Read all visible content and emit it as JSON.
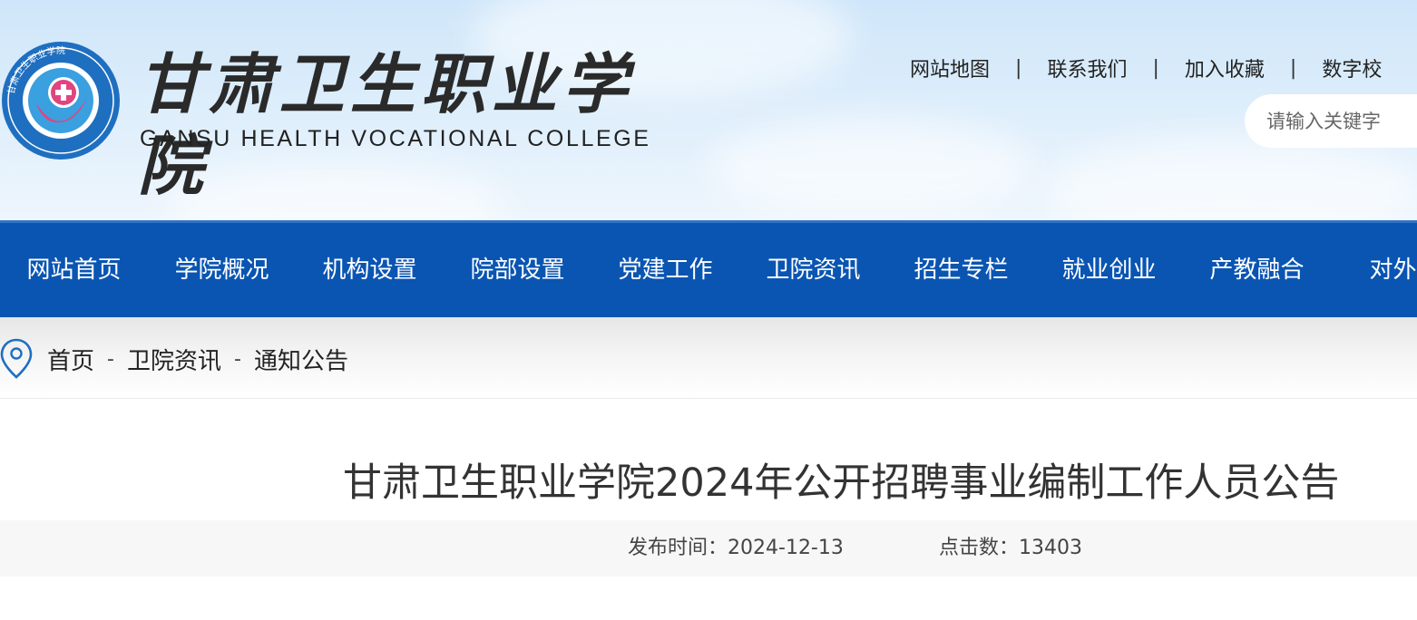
{
  "logo": {
    "name_cn": "甘肃卫生职业学院",
    "name_en": "GANSU HEALTH VOCATIONAL COLLEGE",
    "emblem_ring_text": "甘肃卫生职业学院"
  },
  "top_links": [
    "网站地图",
    "联系我们",
    "加入收藏",
    "数字校"
  ],
  "top_link_separator": "|",
  "search": {
    "placeholder": "请输入关键字"
  },
  "nav": {
    "items": [
      "网站首页",
      "学院概况",
      "机构设置",
      "院部设置",
      "党建工作",
      "卫院资讯",
      "招生专栏",
      "就业创业",
      "产教融合",
      "对外交"
    ]
  },
  "breadcrumb": {
    "items": [
      "首页",
      "卫院资讯",
      "通知公告"
    ],
    "separator": "-"
  },
  "article": {
    "title": "甘肃卫生职业学院2024年公开招聘事业编制工作人员公告",
    "publish_label": "发布时间：",
    "publish_date": "2024-12-13",
    "clicks_label": "点击数：",
    "clicks": "13403"
  },
  "colors": {
    "nav_bg": "#0a55b2",
    "header_sky": "#cfe6fa",
    "emblem_blue": "#1f6fc0",
    "emblem_pink": "#e0457f"
  },
  "icons": {
    "location": "map-pin-icon",
    "emblem": "college-emblem-icon"
  }
}
